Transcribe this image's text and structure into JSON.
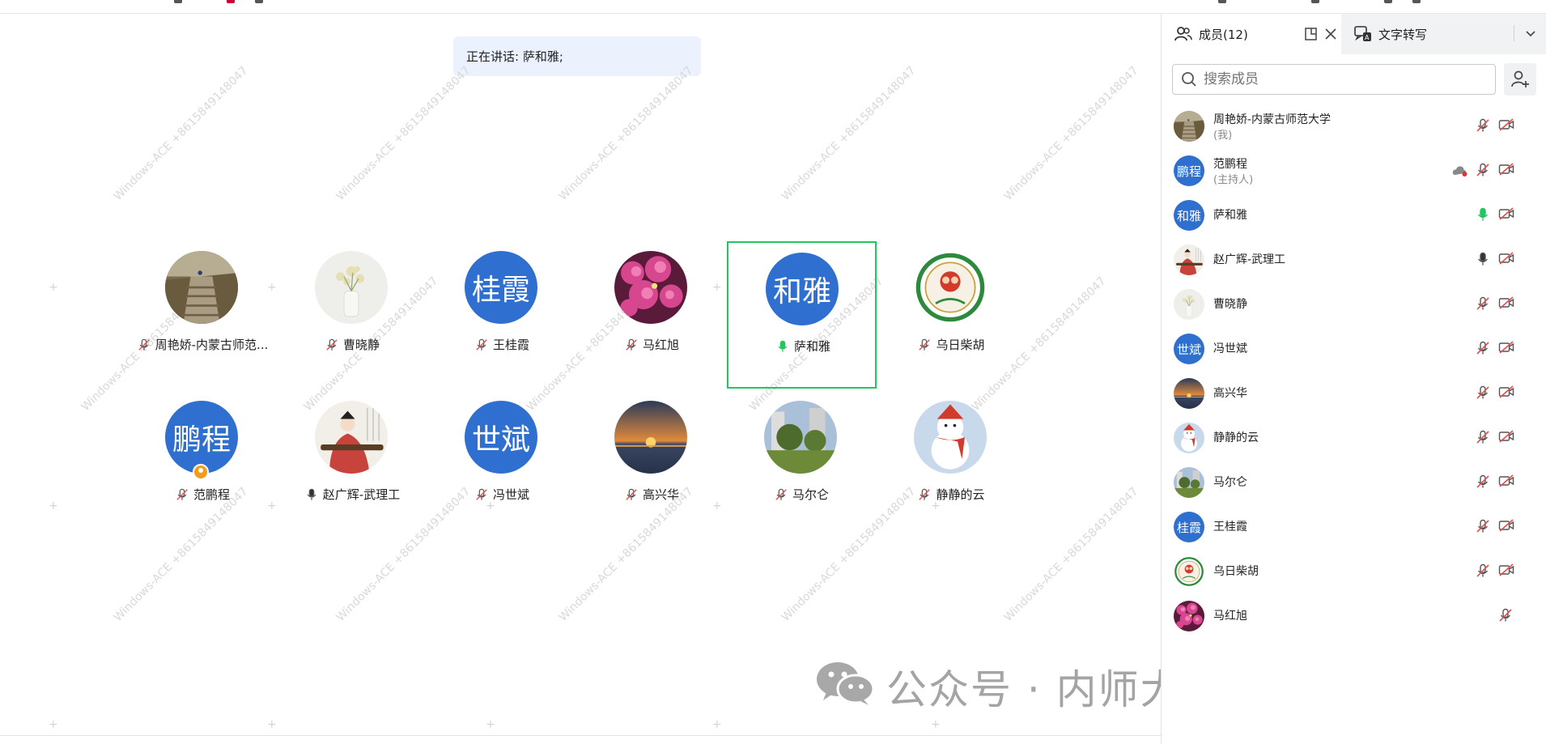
{
  "speaking": {
    "text": "正在讲话: 萨和雅;"
  },
  "grid": [
    {
      "name": "周艳娇-内蒙古师范...",
      "avatar_type": "photo",
      "avatar_kind": "stairs",
      "mic": "muted"
    },
    {
      "name": "曹晓静",
      "avatar_type": "photo",
      "avatar_kind": "flowers-white",
      "mic": "muted"
    },
    {
      "name": "王桂霞",
      "avatar_type": "text",
      "avatar_text": "桂霞",
      "mic": "muted"
    },
    {
      "name": "马红旭",
      "avatar_type": "photo",
      "avatar_kind": "flowers-pink",
      "mic": "muted"
    },
    {
      "name": "萨和雅",
      "avatar_type": "text",
      "avatar_text": "和雅",
      "mic": "speaking",
      "active": true
    },
    {
      "name": "乌日柴胡",
      "avatar_type": "photo",
      "avatar_kind": "emblem",
      "mic": "muted"
    },
    {
      "name": "范鹏程",
      "avatar_type": "text",
      "avatar_text": "鹏程",
      "mic": "muted",
      "host": true
    },
    {
      "name": "赵广辉-武理工",
      "avatar_type": "photo",
      "avatar_kind": "painting",
      "mic": "on"
    },
    {
      "name": "冯世斌",
      "avatar_type": "text",
      "avatar_text": "世斌",
      "mic": "muted"
    },
    {
      "name": "高兴华",
      "avatar_type": "photo",
      "avatar_kind": "sunset",
      "mic": "muted"
    },
    {
      "name": "马尔仑",
      "avatar_type": "photo",
      "avatar_kind": "park",
      "mic": "muted"
    },
    {
      "name": "静静的云",
      "avatar_type": "photo",
      "avatar_kind": "snowman",
      "mic": "muted"
    }
  ],
  "panel": {
    "tab_members": "成员(12)",
    "tab_transcript": "文字转写",
    "search_placeholder": "搜索成员",
    "members": [
      {
        "name": "周艳娇-内蒙古师范大学",
        "role": "(我)",
        "avatar_type": "photo",
        "avatar_kind": "stairs",
        "mic": "muted",
        "cam": "off"
      },
      {
        "name": "范鹏程",
        "role": "(主持人)",
        "avatar_type": "text",
        "avatar_text": "鹏程",
        "mic": "muted",
        "cam": "off",
        "cloud": true
      },
      {
        "name": "萨和雅",
        "avatar_type": "text",
        "avatar_text": "和雅",
        "mic": "speaking",
        "cam": "off"
      },
      {
        "name": "赵广辉-武理工",
        "avatar_type": "photo",
        "avatar_kind": "painting",
        "mic": "on",
        "cam": "off"
      },
      {
        "name": "曹晓静",
        "avatar_type": "photo",
        "avatar_kind": "flowers-white",
        "mic": "muted",
        "cam": "off"
      },
      {
        "name": "冯世斌",
        "avatar_type": "text",
        "avatar_text": "世斌",
        "mic": "muted",
        "cam": "off"
      },
      {
        "name": "高兴华",
        "avatar_type": "photo",
        "avatar_kind": "sunset",
        "mic": "muted",
        "cam": "off"
      },
      {
        "name": "静静的云",
        "avatar_type": "photo",
        "avatar_kind": "snowman",
        "mic": "muted",
        "cam": "off"
      },
      {
        "name": "马尔仑",
        "avatar_type": "photo",
        "avatar_kind": "park",
        "mic": "muted",
        "cam": "off"
      },
      {
        "name": "王桂霞",
        "avatar_type": "text",
        "avatar_text": "桂霞",
        "mic": "muted",
        "cam": "off"
      },
      {
        "name": "乌日柴胡",
        "avatar_type": "photo",
        "avatar_kind": "emblem",
        "mic": "muted",
        "cam": "off"
      },
      {
        "name": "马红旭",
        "avatar_type": "photo",
        "avatar_kind": "flowers-pink",
        "mic": "none",
        "cam": "off"
      }
    ]
  },
  "watermark": {
    "text": "Windows-ACE +8615849148047"
  },
  "footer_watermark": {
    "text": "公众号 · 内师大数科院教学工作"
  },
  "colors": {
    "accent": "#2f6fcf",
    "active_border": "#22c55e",
    "speaking": "#22c55e",
    "muted": "#e05050",
    "banner_bg": "#ebf2fd"
  }
}
